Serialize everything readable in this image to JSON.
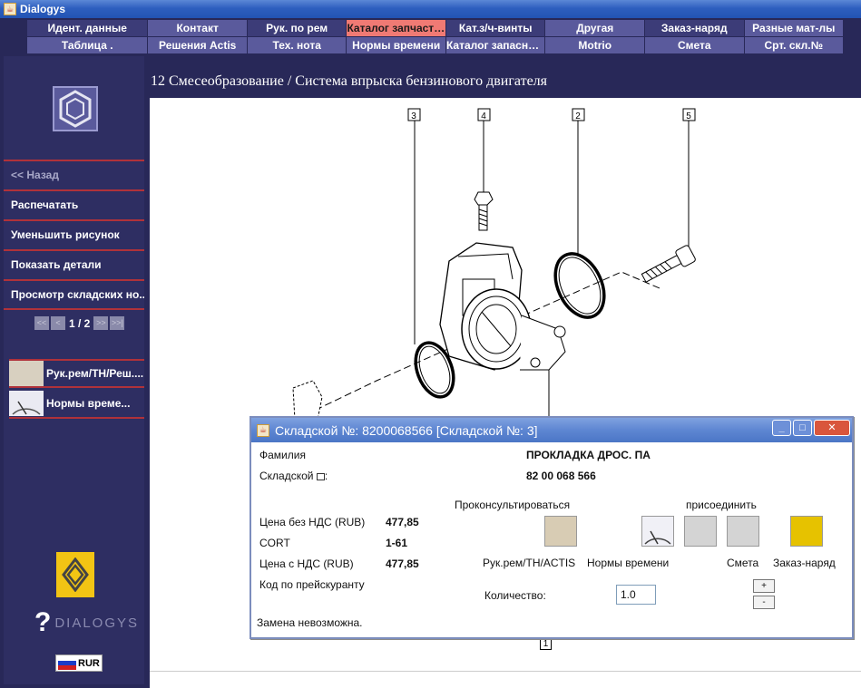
{
  "window": {
    "title": "Dialogys",
    "java_glyph": "☕"
  },
  "menu": {
    "row1": [
      {
        "label": "Идент. данные",
        "state": "dark"
      },
      {
        "label": "Контакт",
        "state": "normal"
      },
      {
        "label": "Рук. по рем",
        "state": "dark"
      },
      {
        "label": "Каталог запчастей",
        "state": "active"
      },
      {
        "label": "Кат.з/ч-винты",
        "state": "dark"
      },
      {
        "label": "Другая",
        "state": "normal"
      },
      {
        "label": "Заказ-наряд",
        "state": "dark"
      },
      {
        "label": "Разные мат-лы",
        "state": "normal"
      }
    ],
    "row2": [
      {
        "label": "Таблица .",
        "state": "normal"
      },
      {
        "label": "Решения Actis",
        "state": "normal"
      },
      {
        "label": "Тех. нота",
        "state": "normal"
      },
      {
        "label": "Нормы времени",
        "state": "normal"
      },
      {
        "label": "Каталог запасны...",
        "state": "normal"
      },
      {
        "label": "Motrio",
        "state": "normal"
      },
      {
        "label": "Смета",
        "state": "normal"
      },
      {
        "label": "Срт. скл.№",
        "state": "normal"
      }
    ]
  },
  "sidebar": {
    "back": "<< Назад",
    "items": [
      "Распечатать",
      "Уменьшить рисунок",
      "Показать детали",
      "Просмотр складских но..."
    ],
    "pager": {
      "first": "<<",
      "prev": "<",
      "text": "1 / 2",
      "next": ">>",
      "last": ">>|"
    },
    "docs": [
      "Рук.рем/ТН/Реш....",
      "Нормы време..."
    ],
    "brand": "DIALOGYS",
    "brand_mark": "?",
    "currency": "RUR"
  },
  "page": {
    "heading": "12 Смесеобразование / Система впрыска бензинового двигателя"
  },
  "drawing": {
    "callouts": [
      "3",
      "4",
      "2",
      "5",
      "1"
    ]
  },
  "dialog": {
    "title": "Складской №: 8200068566 [Складской №: 3]",
    "win_buttons": {
      "minimize": "_",
      "maximize": "□",
      "close": "✕"
    },
    "family_label": "Фамилия",
    "family_value": "ПРОКЛАДКА ДРОС. ПА",
    "stock_label": "Складской",
    "stock_value": "82 00 068 566",
    "consult_label": "Проконсультироваться",
    "attach_label": "присоединить",
    "price_ex_vat_label": "Цена без НДС (RUB)",
    "price_ex_vat": "477,85",
    "cort_label": "CORT",
    "cort_value": "1-61",
    "price_vat_label": "Цена с НДС (RUB)",
    "price_vat": "477,85",
    "pricelist_label": "Код по прейскуранту",
    "doc_labels": [
      "Рук.рем/ТН/ACTIS",
      "Нормы времени",
      "Смета",
      "Заказ-наряд"
    ],
    "qty_label": "Количество:",
    "qty_value": "1.0",
    "plus": "+",
    "minus": "-",
    "status": "Замена невозможна."
  }
}
